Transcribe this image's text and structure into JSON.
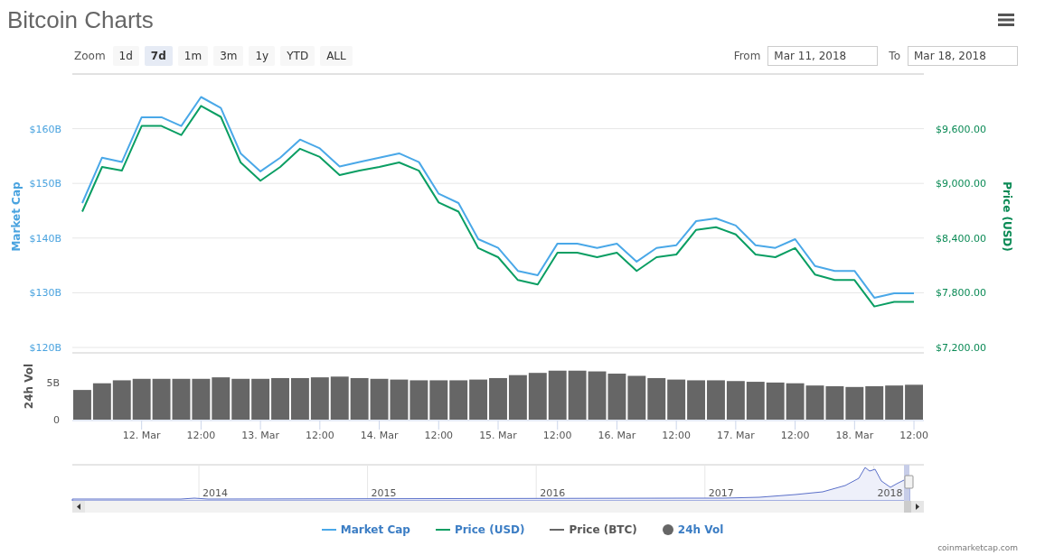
{
  "header": {
    "title": "Bitcoin Charts"
  },
  "zoom": {
    "label": "Zoom",
    "buttons": [
      {
        "label": "1d",
        "selected": false
      },
      {
        "label": "7d",
        "selected": true
      },
      {
        "label": "1m",
        "selected": false
      },
      {
        "label": "3m",
        "selected": false
      },
      {
        "label": "1y",
        "selected": false
      },
      {
        "label": "YTD",
        "selected": false
      },
      {
        "label": "ALL",
        "selected": false
      }
    ]
  },
  "range": {
    "from_label": "From",
    "from_value": "Mar 11, 2018",
    "to_label": "To",
    "to_value": "Mar 18, 2018"
  },
  "market_cap_chart": {
    "chart_data": {
      "type": "line",
      "ylabel": "Market Cap",
      "grid": true,
      "ylim": [
        120,
        170
      ],
      "categories": [
        null,
        null,
        null,
        null,
        null,
        null,
        null,
        null,
        null,
        null,
        null,
        null,
        null,
        null,
        null,
        null,
        null,
        null,
        null,
        null,
        null,
        null,
        null,
        null,
        null,
        null,
        null,
        null,
        null,
        null,
        null,
        null,
        null,
        null,
        null,
        null,
        null,
        null,
        null,
        null,
        null,
        null,
        null
      ],
      "yticks": [
        {
          "value": 160,
          "label": "$160B"
        },
        {
          "value": 150,
          "label": "$150B"
        },
        {
          "value": 140,
          "label": "$140B"
        },
        {
          "value": 130,
          "label": "$130B"
        },
        {
          "value": 120,
          "label": "$120B"
        }
      ],
      "series": [
        {
          "color": "#4aa8e8",
          "values": [
            146.4,
            154.7,
            153.9,
            162.1,
            162.1,
            160.5,
            165.8,
            163.8,
            155.5,
            152.2,
            154.7,
            158.0,
            156.4,
            153.1,
            153.9,
            154.7,
            155.5,
            153.9,
            148.1,
            146.4,
            139.8,
            138.2,
            134.0,
            133.2,
            139.0,
            139.0,
            138.2,
            139.0,
            135.7,
            138.2,
            138.7,
            143.1,
            143.6,
            142.3,
            138.7,
            138.2,
            139.8,
            134.9,
            134.0,
            134.0,
            129.1,
            129.9,
            129.9
          ]
        }
      ]
    }
  },
  "price_chart": {
    "chart_data": {
      "type": "line",
      "ylabel": "Price (USD)",
      "ylim": [
        7200,
        10200
      ],
      "categories": [
        null,
        null,
        null,
        null,
        null,
        null,
        null,
        null,
        null,
        null,
        null,
        null,
        null,
        null,
        null,
        null,
        null,
        null,
        null,
        null,
        null,
        null,
        null,
        null,
        null,
        null,
        null,
        null,
        null,
        null,
        null,
        null,
        null,
        null,
        null,
        null,
        null,
        null,
        null,
        null,
        null,
        null,
        null
      ],
      "yticks": [
        {
          "value": 9600,
          "label": "$9,600.00"
        },
        {
          "value": 9000,
          "label": "$9,000.00"
        },
        {
          "value": 8400,
          "label": "$8,400.00"
        },
        {
          "value": 7800,
          "label": "$7,800.00"
        },
        {
          "value": 7200,
          "label": "$7,200.00"
        }
      ],
      "series": [
        {
          "color": "#0a9e63",
          "values": [
            8690,
            9180,
            9140,
            9630,
            9630,
            9530,
            9850,
            9730,
            9230,
            9030,
            9180,
            9380,
            9290,
            9090,
            9140,
            9180,
            9230,
            9140,
            8790,
            8690,
            8290,
            8190,
            7940,
            7890,
            8240,
            8240,
            8190,
            8240,
            8040,
            8190,
            8220,
            8490,
            8520,
            8440,
            8220,
            8190,
            8290,
            8000,
            7940,
            7940,
            7650,
            7700,
            7700
          ]
        }
      ]
    }
  },
  "volume_chart": {
    "chart_data": {
      "type": "bar",
      "ylabel": "24h Vol",
      "categories": [
        null,
        null,
        null,
        "12. Mar",
        null,
        null,
        "12:00",
        null,
        null,
        "13. Mar",
        null,
        null,
        "12:00",
        null,
        null,
        "14. Mar",
        null,
        null,
        "12:00",
        null,
        null,
        "15. Mar",
        null,
        null,
        "12:00",
        null,
        null,
        "16. Mar",
        null,
        null,
        "12:00",
        null,
        null,
        "17. Mar",
        null,
        null,
        "12:00",
        null,
        null,
        "18. Mar",
        null,
        null,
        "12:00"
      ],
      "values": [
        4.0,
        4.9,
        5.3,
        5.5,
        5.5,
        5.5,
        5.5,
        5.7,
        5.5,
        5.5,
        5.6,
        5.6,
        5.7,
        5.8,
        5.6,
        5.5,
        5.4,
        5.3,
        5.3,
        5.3,
        5.4,
        5.6,
        6.0,
        6.3,
        6.6,
        6.6,
        6.5,
        6.2,
        5.9,
        5.6,
        5.4,
        5.3,
        5.3,
        5.2,
        5.1,
        5.0,
        4.9,
        4.6,
        4.5,
        4.4,
        4.5,
        4.6,
        4.7
      ],
      "ylim": [
        0,
        9
      ],
      "yticks": [
        {
          "value": 5,
          "label": "5B"
        },
        {
          "value": 0,
          "label": "0"
        }
      ]
    }
  },
  "navigator": {
    "year_labels": [
      "2014",
      "2015",
      "2016",
      "2017",
      "2018"
    ]
  },
  "legend": [
    {
      "label": "Market Cap",
      "kind": "line",
      "color": "#4aa8e8",
      "dimmed": false
    },
    {
      "label": "Price (USD)",
      "kind": "line",
      "color": "#0a9e63",
      "dimmed": false
    },
    {
      "label": "Price (BTC)",
      "kind": "line",
      "color": "#666666",
      "dimmed": true
    },
    {
      "label": "24h Vol",
      "kind": "dot",
      "color": "#666666",
      "dimmed": false
    }
  ],
  "credit": "coinmarketcap.com"
}
